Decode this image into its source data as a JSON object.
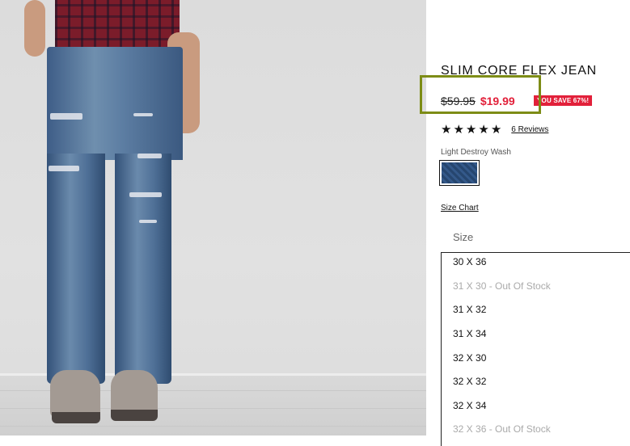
{
  "product": {
    "title": "SLIM CORE FLEX JEAN",
    "original_price": "$59.95",
    "sale_price": "$19.99",
    "save_badge": "YOU SAVE 67%!",
    "rating_stars": 5,
    "reviews_link": "6 Reviews",
    "color_name": "Light Destroy Wash",
    "size_chart_link": "Size Chart",
    "size_label": "Size",
    "size_options": [
      {
        "label": "30 X 36",
        "available": true
      },
      {
        "label": "31 X 30 - Out Of Stock",
        "available": false
      },
      {
        "label": "31 X 32",
        "available": true
      },
      {
        "label": "31 X 34",
        "available": true
      },
      {
        "label": "32 X 30",
        "available": true
      },
      {
        "label": "32 X 32",
        "available": true
      },
      {
        "label": "32 X 34",
        "available": true
      },
      {
        "label": "32 X 36 - Out Of Stock",
        "available": false
      }
    ]
  },
  "colors": {
    "sale_red": "#e2203a",
    "highlight_olive": "#7d8c16",
    "out_of_stock_gray": "#aaaaaa"
  }
}
